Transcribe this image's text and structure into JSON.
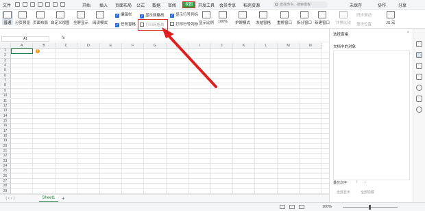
{
  "menubar": {
    "file": "文件",
    "tabs": [
      "开始",
      "插入",
      "页面布局",
      "公式",
      "数据",
      "审阅"
    ],
    "active_tab": "视图",
    "tabs_after": [
      "开发工具",
      "会员专享",
      "稻壳资源"
    ],
    "search_placeholder": "查找命令、搜索模板",
    "sync": "未保存",
    "collab": "协作",
    "share": "分享"
  },
  "ribbon": {
    "normal": "普通",
    "page_break": "分页预览",
    "page_layout": "页面布局",
    "custom_view": "自定义视图",
    "fullscreen": "全屏显示",
    "reading_mode": "阅读模式",
    "edit_bar": "编辑栏",
    "task_pane": "任务窗格",
    "show_grid": "显示网格线",
    "print_grid": "打印网格线",
    "show_headers": "显示行号列标",
    "print_headers": "打印行号列标",
    "zoom": "显示比例",
    "zoom_100": "100%",
    "eye_mode": "护眼模式",
    "freeze": "冻结窗格",
    "rearrange": "重排窗口",
    "split": "拆分窗口",
    "new_window": "新建窗口",
    "side_by_side": "并排比较",
    "sync_scroll": "同步滚动",
    "reset_pos": "重设位置",
    "js": "JS 宏"
  },
  "formula": {
    "cell_ref": "A1",
    "fx": "fx"
  },
  "sheet": {
    "columns": [
      "A",
      "B",
      "C",
      "D",
      "E",
      "F",
      "G",
      "H",
      "I",
      "J",
      "K",
      "L",
      "M",
      "N"
    ],
    "rows": [
      "1",
      "2",
      "3",
      "4",
      "5",
      "6",
      "7",
      "8",
      "9",
      "10",
      "11",
      "12",
      "13",
      "14",
      "15",
      "16",
      "17",
      "18",
      "19",
      "20",
      "21",
      "22",
      "23",
      "24",
      "25",
      "26",
      "27",
      "28",
      "29"
    ],
    "tab_name": "Sheet1",
    "add": "+"
  },
  "pane": {
    "title": "选择窗格",
    "objects": "文档中的对象",
    "order": "叠放次序",
    "show_all": "全部显示",
    "hide_all": "全部隐藏"
  },
  "status": {
    "zoom": "100%"
  },
  "colors": {
    "accent": "#2f9e44",
    "highlight": "#d33333",
    "grid": "#e6e6e6"
  }
}
